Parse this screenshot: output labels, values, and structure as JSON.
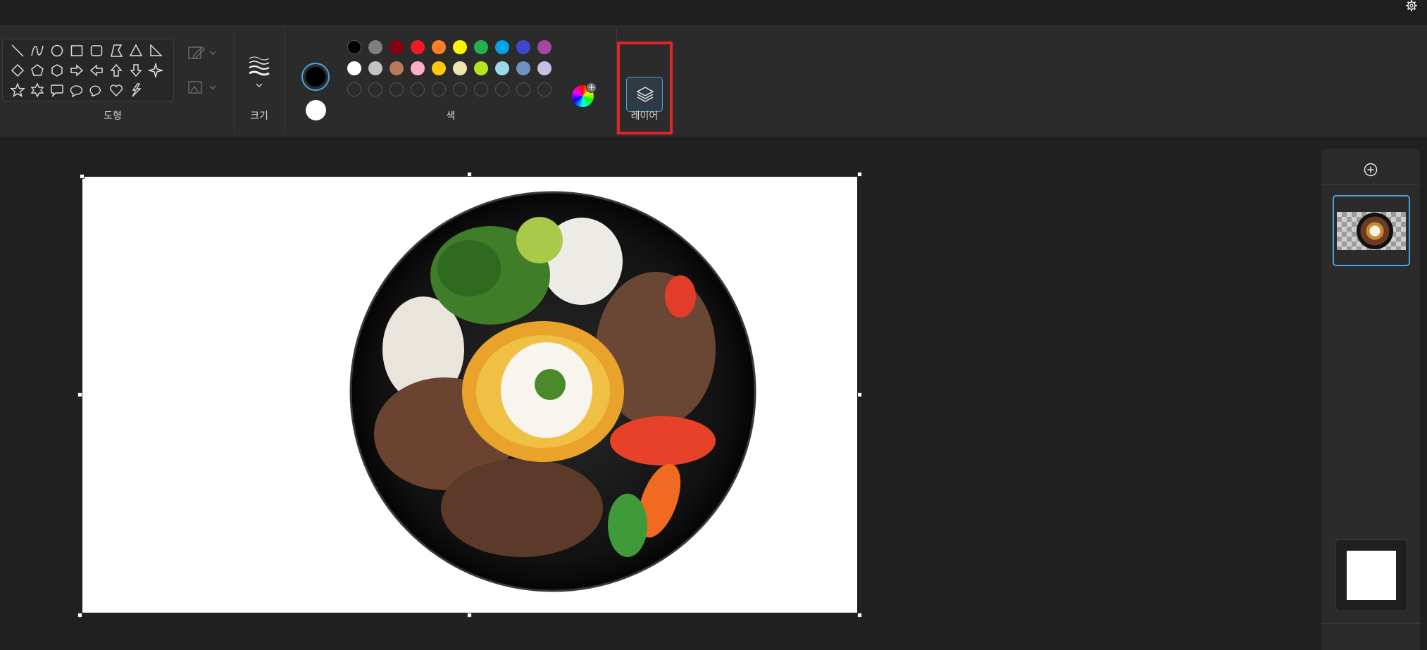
{
  "ribbon": {
    "shapes_label": "도형",
    "size_label": "크기",
    "colors_label": "색",
    "layers_label": "레이어"
  },
  "shapes": {
    "row1": [
      "line-icon",
      "curve-icon",
      "oval-icon",
      "rectangle-icon",
      "rounded-rectangle-icon",
      "polygon-icon",
      "triangle-icon",
      "right-triangle-icon"
    ],
    "row2": [
      "diamond-icon",
      "pentagon-icon",
      "hexagon-icon",
      "right-arrow-icon",
      "left-arrow-icon",
      "up-arrow-icon",
      "down-arrow-icon",
      "four-point-star-icon"
    ],
    "row3": [
      "five-point-star-icon",
      "six-point-star-icon",
      "rounded-callout-icon",
      "oval-callout-icon",
      "cloud-callout-icon",
      "heart-icon",
      "lightning-icon"
    ]
  },
  "colors": {
    "primary": "#000000",
    "secondary": "#ffffff",
    "row1": [
      "#000000",
      "#7f7f7f",
      "#880015",
      "#ed1c24",
      "#ff7f27",
      "#fff200",
      "#22b14c",
      "#00a2e8",
      "#3f48cc",
      "#a349a4"
    ],
    "row2": [
      "#ffffff",
      "#c3c3c3",
      "#b97a57",
      "#ffaec9",
      "#ffc90e",
      "#efe4b0",
      "#b5e61d",
      "#99d9ea",
      "#7092be",
      "#c8bfe7"
    ],
    "accent": "#4aa3df",
    "highlight": "#e0242c"
  },
  "layers_panel": {
    "layer_count": 2,
    "selected_layer": 1
  }
}
